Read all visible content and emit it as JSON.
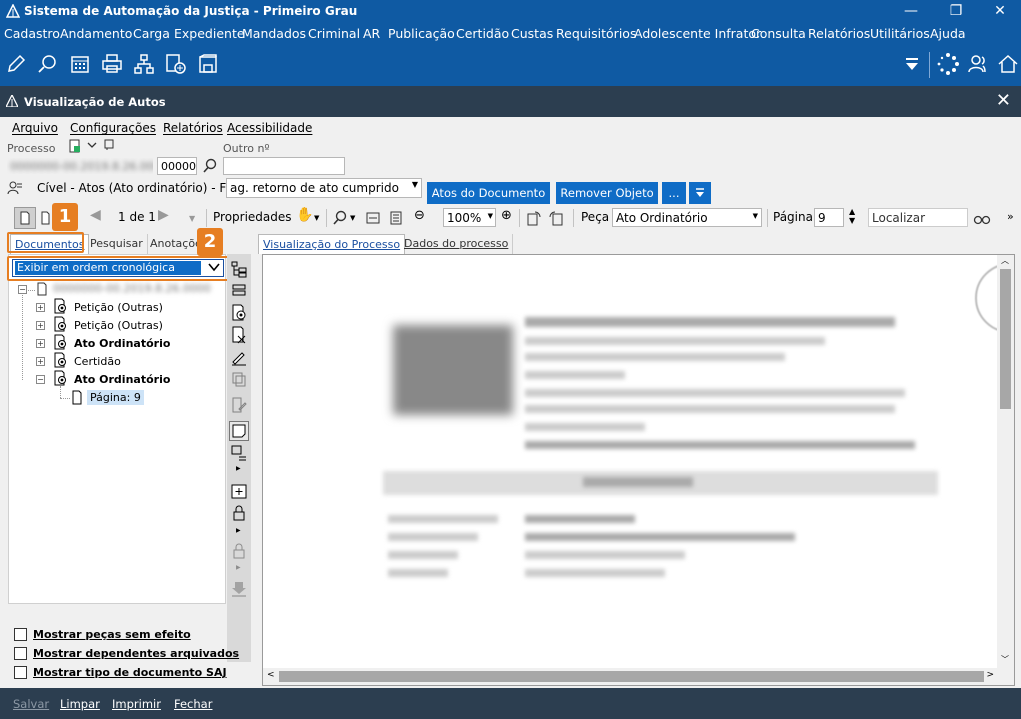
{
  "app": {
    "title": "Sistema de Automação da Justiça - Primeiro Grau",
    "minimize": "—",
    "restore": "❐",
    "close": "✕"
  },
  "main_menu": [
    "Cadastro",
    "Andamento",
    "Carga",
    "Expediente",
    "Mandados",
    "Criminal",
    "AR",
    "Publicação",
    "Certidão",
    "Custas",
    "Requisitórios",
    "Adolescente Infrator",
    "Consulta",
    "Relatórios",
    "Utilitários",
    "Ajuda"
  ],
  "window": {
    "title": "Visualização de Autos",
    "close": "✕"
  },
  "sub_menu": [
    "Arquivo",
    "Configurações",
    "Relatórios",
    "Acessibilidade"
  ],
  "process": {
    "label": "Processo",
    "number_blurred": "0000000-00.2019.8.26.0000",
    "suffix": "00000",
    "other_label": "Outro nº",
    "other_value": ""
  },
  "class_line": {
    "text": "Cível - Atos (Ato ordinatório) - Fila:",
    "queue_value": "ag. retorno de ato cumprido",
    "btn_atos": "Atos do Documento",
    "btn_remover": "Remover Objeto",
    "btn_more": "..."
  },
  "doc_toolbar": {
    "page_of": "1 de 1",
    "properties": "Propriedades",
    "zoom": "100%",
    "peca_label": "Peça",
    "peca_value": "Ato Ordinatório",
    "pagina_label": "Página",
    "pagina_value": "9",
    "localizar": "Localizar"
  },
  "left_tabs": [
    "Documentos",
    "Pesquisar",
    "Anotações"
  ],
  "order_dropdown": "Exibir em ordem cronológica",
  "tree": {
    "root_blurred": "0000000-00.2019.8.26.0000",
    "items": [
      {
        "label": "Petição (Outras)",
        "bold": false
      },
      {
        "label": "Petição (Outras)",
        "bold": false
      },
      {
        "label": "Ato Ordinatório",
        "bold": true
      },
      {
        "label": "Certidão",
        "bold": false
      },
      {
        "label": "Ato Ordinatório",
        "bold": true
      }
    ],
    "page_node": "Página: 9"
  },
  "badges": [
    "1",
    "2"
  ],
  "checkboxes": [
    "Mostrar peças sem efeito",
    "Mostrar dependentes arquivados",
    "Mostrar tipo de documento SAJ"
  ],
  "right_tabs": [
    "Visualização do Processo",
    "Dados do processo"
  ],
  "bottom_actions": [
    {
      "label": "Salvar",
      "enabled": false
    },
    {
      "label": "Limpar",
      "enabled": true
    },
    {
      "label": "Imprimir",
      "enabled": true
    },
    {
      "label": "Fechar",
      "enabled": true
    }
  ],
  "colors": {
    "brand_blue": "#0f5aa3",
    "dark_header": "#2c3e50",
    "accent_orange": "#e67e22",
    "button_blue": "#0f6cc6"
  }
}
